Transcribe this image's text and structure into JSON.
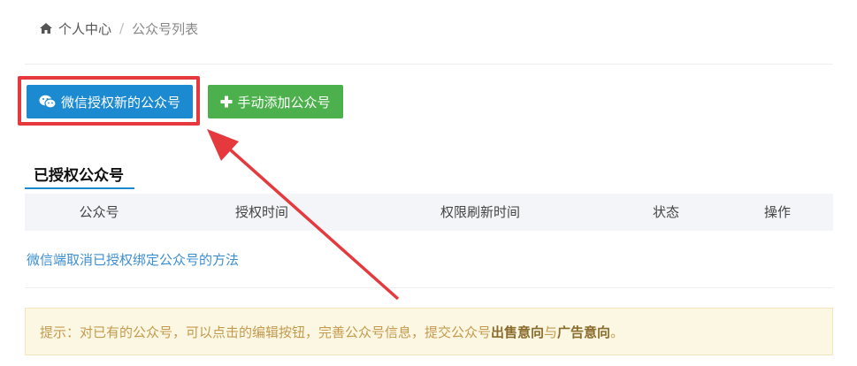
{
  "breadcrumb": {
    "home": "个人中心",
    "separator": "/",
    "current": "公众号列表"
  },
  "toolbar": {
    "wechat_auth_label": "微信授权新的公众号",
    "manual_add_label": "手动添加公众号"
  },
  "section": {
    "title": "已授权公众号"
  },
  "table": {
    "columns": [
      "公众号",
      "授权时间",
      "权限刷新时间",
      "状态",
      "操作"
    ]
  },
  "help_link": "微信端取消已授权绑定公众号的方法",
  "tip": {
    "prefix": "提示：对已有的公众号，可以点击的编辑按钮，完善公众号信息，提交公众号",
    "highlight1": "出售意向",
    "connector": "与",
    "highlight2": "广告意向",
    "suffix": "。"
  },
  "colors": {
    "primary": "#1b8ad0",
    "success": "#4cb04c",
    "annotation_red": "#e5393e",
    "link": "#3e8fd0"
  }
}
